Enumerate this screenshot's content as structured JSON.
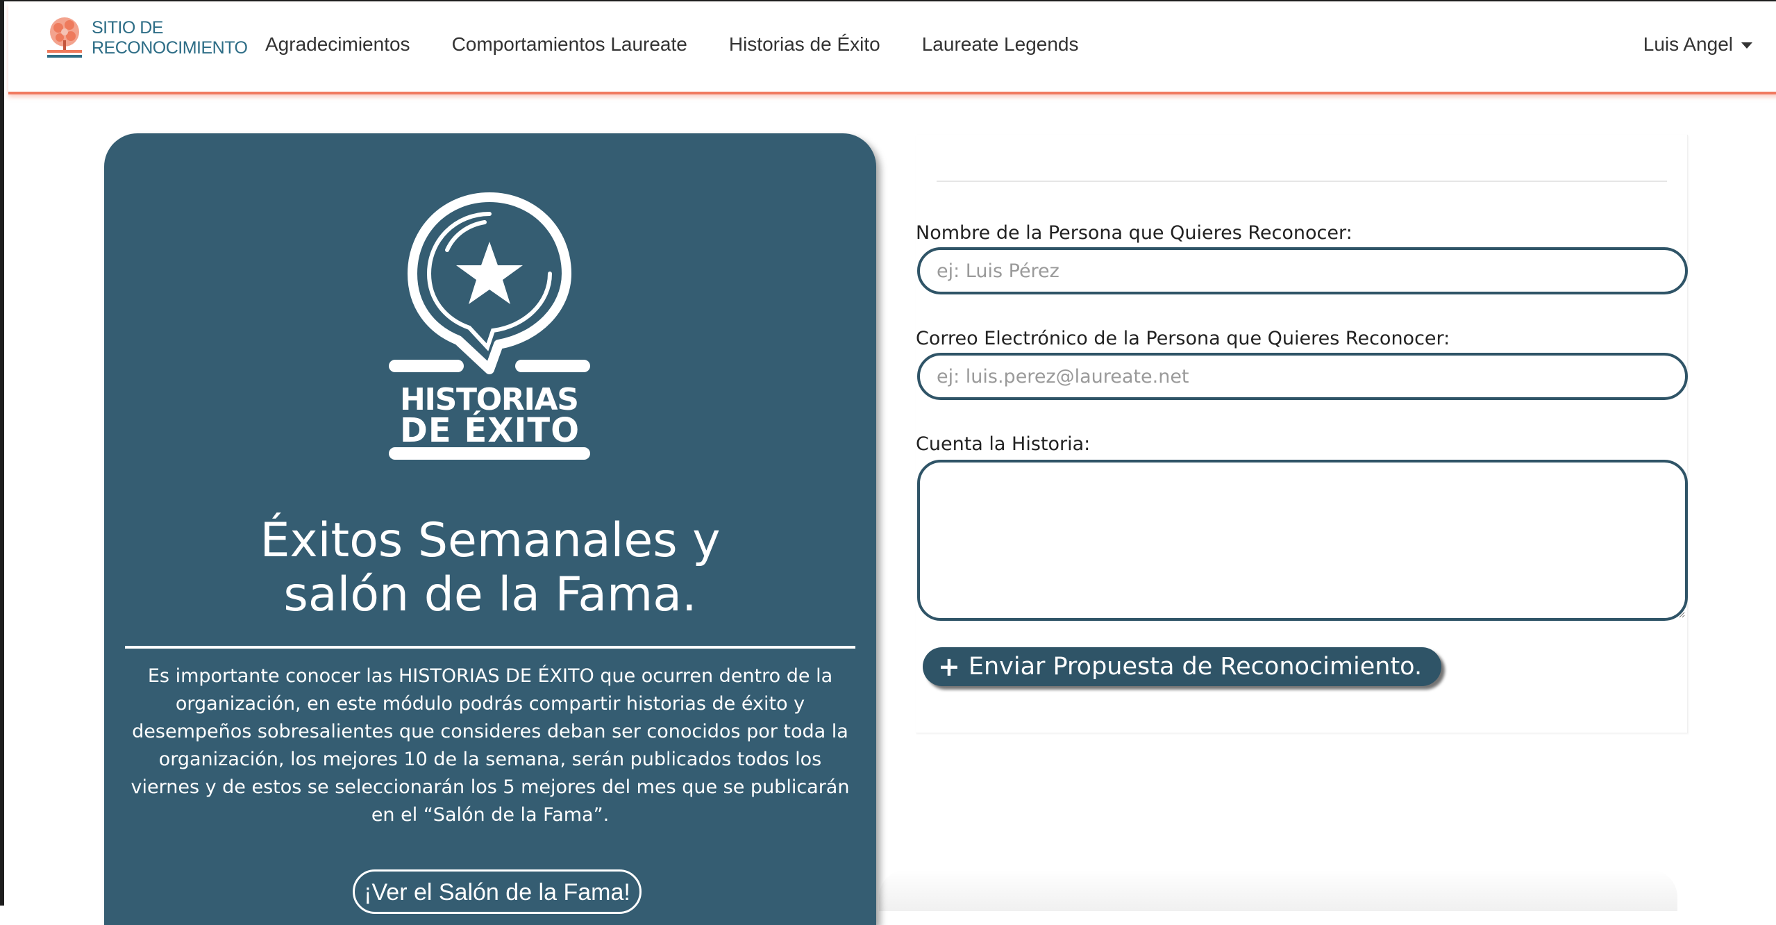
{
  "brand": {
    "line1": "SITIO DE",
    "line2": "RECONOCIMIENTO"
  },
  "nav": {
    "items": [
      {
        "label": "Agradecimientos"
      },
      {
        "label": "Comportamientos Laureate"
      },
      {
        "label": "Historias de Éxito"
      },
      {
        "label": "Laureate Legends"
      }
    ],
    "user": "Luis Angel"
  },
  "hero": {
    "logo_text_line1": "HISTORIAS",
    "logo_text_line2": "DE ÉXITO",
    "title_line1": "Éxitos Semanales y",
    "title_line2": "salón de la Fama.",
    "description": "Es importante conocer las HISTORIAS DE ÉXITO que ocurren dentro de la organización, en este módulo podrás compartir historias de éxito y desempeños sobresalientes que consideres deban ser conocidos por toda la organización, los mejores 10 de la semana, serán publicados todos los viernes y de estos se seleccionarán los 5 mejores del mes que se publicarán en el “Salón de la Fama”.",
    "button_label": "¡Ver el Salón de la Fama!"
  },
  "form": {
    "name_label": "Nombre de la Persona que Quieres Reconocer:",
    "name_placeholder": "ej: Luis Pérez",
    "name_value": "",
    "email_label": "Correo Electrónico de la Persona que Quieres Reconocer:",
    "email_placeholder": "ej: luis.perez@laureate.net",
    "email_value": "",
    "story_label": "Cuenta la Historia:",
    "story_value": "",
    "submit_label": "Enviar Propuesta de Reconocimiento."
  },
  "colors": {
    "panel": "#355d72",
    "accent": "#f07a60",
    "brand_text": "#2d6d86",
    "input_border": "#2f5467"
  },
  "icons": {
    "brand": "tree-logo-icon",
    "hero": "star-speech-bubble-icon",
    "user_menu": "caret-down-icon",
    "submit": "plus-icon"
  }
}
